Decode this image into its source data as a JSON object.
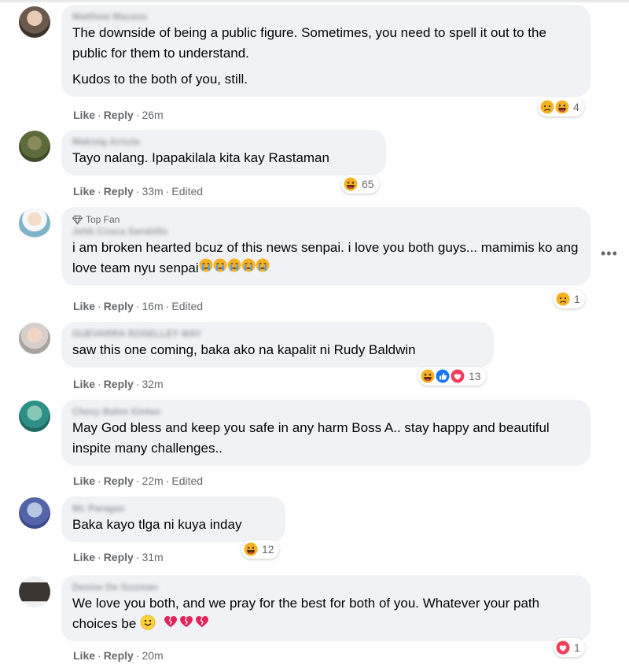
{
  "comments": [
    {
      "author": "Matthew Macaso",
      "lines": [
        "The downside of being a public figure. Sometimes, you need to spell it out to the public for them to understand.",
        "Kudos to the both of you, still."
      ],
      "like": "Like",
      "reply": "Reply",
      "time": "26m",
      "edited": "",
      "reactions": [
        "sad",
        "haha"
      ],
      "reaction_count": "4"
    },
    {
      "author": "Makisig Arriola",
      "lines": [
        "Tayo nalang. Ipapakilala kita kay Rastaman"
      ],
      "like": "Like",
      "reply": "Reply",
      "time": "33m",
      "edited": "Edited",
      "reactions": [
        "haha"
      ],
      "reaction_count": "65"
    },
    {
      "badge": "Top Fan",
      "author": "Jehb Cosca Sarabillo",
      "lines": [
        "i am broken hearted bcuz of this news senpai. i love you both guys... mamimis ko ang love team nyu senpai"
      ],
      "like": "Like",
      "reply": "Reply",
      "time": "16m",
      "edited": "Edited",
      "reactions": [
        "sad"
      ],
      "reaction_count": "1"
    },
    {
      "author": "GUEVARRA ROSELLEY MAY",
      "lines": [
        "saw this one coming, baka ako na kapalit ni Rudy Baldwin"
      ],
      "like": "Like",
      "reply": "Reply",
      "time": "32m",
      "edited": "",
      "reactions": [
        "haha",
        "like",
        "love"
      ],
      "reaction_count": "13"
    },
    {
      "author": "Chezy Balen Kintao",
      "lines": [
        "May God bless and keep you safe in any harm Boss A.. stay happy and beautiful inspite many challenges.."
      ],
      "like": "Like",
      "reply": "Reply",
      "time": "22m",
      "edited": "Edited",
      "reactions": [],
      "reaction_count": ""
    },
    {
      "author": "Mc Paragas",
      "lines": [
        "Baka kayo tlga ni kuya inday"
      ],
      "like": "Like",
      "reply": "Reply",
      "time": "31m",
      "edited": "",
      "reactions": [
        "haha"
      ],
      "reaction_count": "12"
    },
    {
      "author": "Denise De Guzman",
      "lines": [
        "We love you both, and we pray for the best for both of you. Whatever your path choices be"
      ],
      "like": "Like",
      "reply": "Reply",
      "time": "20m",
      "edited": "",
      "reactions": [
        "love"
      ],
      "reaction_count": "1"
    }
  ],
  "more_menu": "•••",
  "colors": {
    "bubble": "#f0f2f5",
    "meta_text": "#65676b",
    "haha": "#f7b125",
    "like": "#1877f2",
    "love": "#f33e58"
  }
}
